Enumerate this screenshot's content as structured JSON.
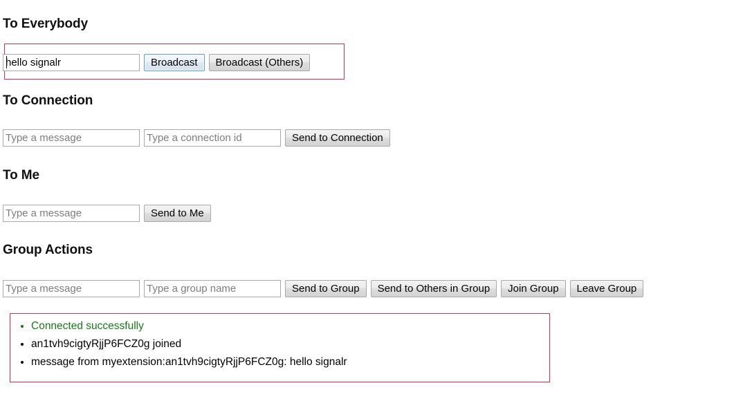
{
  "sections": {
    "everybody": {
      "title": "To Everybody",
      "message_input": {
        "value": "hello signalr",
        "placeholder": "Type a message"
      },
      "broadcast_button": "Broadcast",
      "broadcast_others_button": "Broadcast (Others)"
    },
    "connection": {
      "title": "To Connection",
      "message_input": {
        "value": "",
        "placeholder": "Type a message"
      },
      "connection_id_input": {
        "value": "",
        "placeholder": "Type a connection id"
      },
      "send_button": "Send to Connection"
    },
    "me": {
      "title": "To Me",
      "message_input": {
        "value": "",
        "placeholder": "Type a message"
      },
      "send_button": "Send to Me"
    },
    "group": {
      "title": "Group Actions",
      "message_input": {
        "value": "",
        "placeholder": "Type a message"
      },
      "group_name_input": {
        "value": "",
        "placeholder": "Type a group name"
      },
      "send_to_group_button": "Send to Group",
      "send_to_others_button": "Send to Others in Group",
      "join_group_button": "Join Group",
      "leave_group_button": "Leave Group"
    }
  },
  "log": {
    "items": [
      {
        "text": "Connected successfully",
        "kind": "success"
      },
      {
        "text": "an1tvh9cigtyRjjP6FCZ0g joined",
        "kind": "normal"
      },
      {
        "text": "message from myextension:an1tvh9cigtyRjjP6FCZ0g: hello signalr",
        "kind": "normal"
      }
    ]
  },
  "colors": {
    "highlight_border": "#c9344a",
    "success_text": "#1a7a1a",
    "focus_border": "#5b9dd9"
  }
}
